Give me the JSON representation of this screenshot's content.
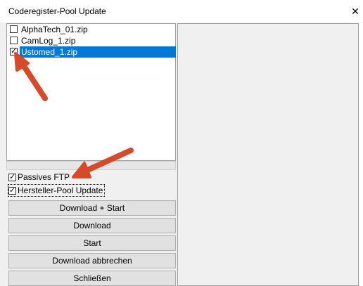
{
  "window": {
    "title": "Coderegister-Pool Update",
    "close_glyph": "✕"
  },
  "files": [
    {
      "name": "AlphaTech_01.zip",
      "checked": false,
      "selected": false
    },
    {
      "name": "CamLog_1.zip",
      "checked": false,
      "selected": false
    },
    {
      "name": "Ustomed_1.zip",
      "checked": true,
      "selected": true
    }
  ],
  "options": {
    "passive_ftp": {
      "label": "Passives FTP",
      "checked": true
    },
    "manufacturer_pool": {
      "label": "Hersteller-Pool Update",
      "checked": true
    }
  },
  "buttons": {
    "download_start": "Download + Start",
    "download": "Download",
    "start": "Start",
    "download_cancel": "Download abbrechen",
    "close": "Schließen"
  },
  "colors": {
    "selection": "#0078d7",
    "annotation_arrow": "#d64a2a"
  }
}
